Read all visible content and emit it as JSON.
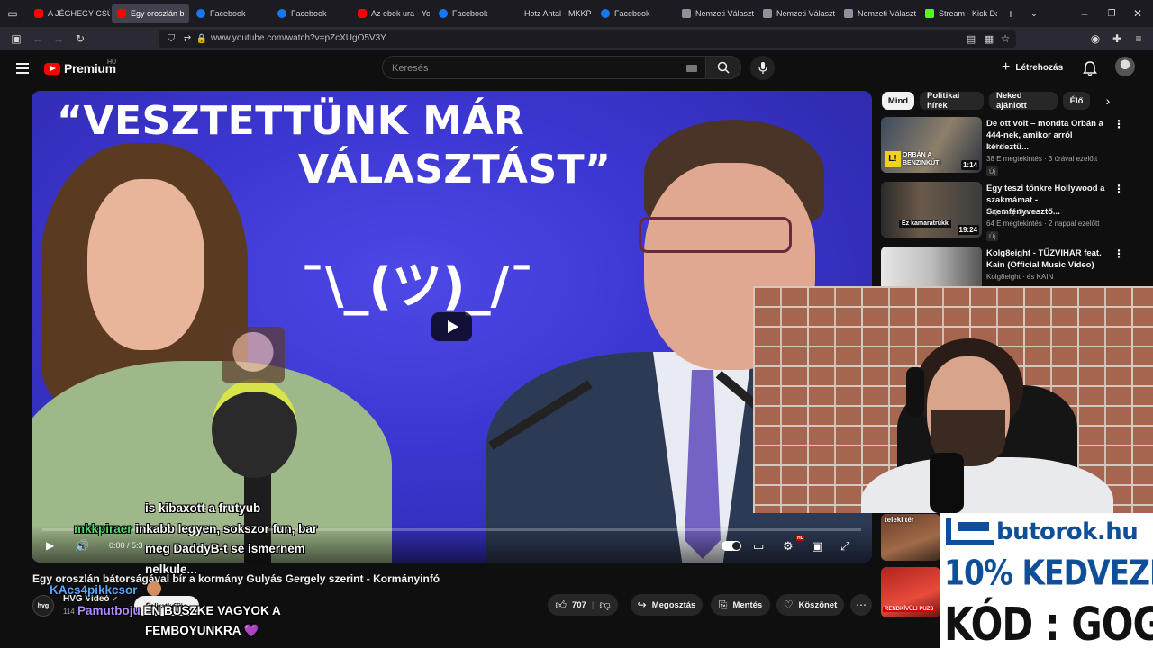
{
  "browser": {
    "tabs": [
      {
        "label": "A JÉGHEGY CSÚC",
        "icon": "youtube-icon",
        "active": false
      },
      {
        "label": "Egy oroszlán b",
        "icon": "youtube-icon",
        "active": true
      },
      {
        "label": "Facebook",
        "icon": "facebook-icon",
        "active": false
      },
      {
        "label": "Facebook",
        "icon": "facebook-icon",
        "active": false
      },
      {
        "label": "Az ebek ura - You",
        "icon": "youtube-icon",
        "active": false
      },
      {
        "label": "Facebook",
        "icon": "facebook-icon",
        "active": false
      },
      {
        "label": "Hotz Antal - MKKP",
        "icon": "none",
        "active": false
      },
      {
        "label": "Facebook",
        "icon": "facebook-icon",
        "active": false
      },
      {
        "label": "Nemzeti Választá",
        "icon": "document-icon",
        "active": false
      },
      {
        "label": "Nemzeti Választá",
        "icon": "document-icon",
        "active": false
      },
      {
        "label": "Nemzeti Választá",
        "icon": "document-icon",
        "active": false
      },
      {
        "label": "Stream - Kick Da",
        "icon": "kick-icon",
        "active": false
      }
    ],
    "url": "www.youtube.com/watch?v=pZcXUgO5V3Y"
  },
  "header": {
    "logo_text": "Premium",
    "logo_region": "HU",
    "search_placeholder": "Keresés",
    "create_label": "Létrehozás"
  },
  "video": {
    "thumb_title_line1": "“VESZTETTÜNK MÁR",
    "thumb_title_line2": "VÁLASZTÁST”",
    "thumb_shrug": "¯\\_(ツ)_/¯",
    "time": "0:00 / 5:3",
    "progress": 0,
    "title": "Egy oroszlán bátorságával bír a kormány Gulyás Gergely szerint - Kormányinfó",
    "channel_name": "HVG Videó",
    "channel_avatar_text": "hvg",
    "subscribers": "114",
    "subscribe_label": "Feliratkozás",
    "likes": "707",
    "share_label": "Megosztás",
    "save_label": "Mentés",
    "thanks_label": "Köszönet"
  },
  "chips": [
    "Mind",
    "Politikai hírek",
    "Neked ajánlott",
    "Élő"
  ],
  "recommendations": [
    {
      "title": "De ott volt – mondta Orbán a 444-nek, amikor arról kérdeztü...",
      "channel": "444.hu",
      "meta": "38 E megtekintés · 3 órával ezelőtt",
      "badge": "Új",
      "duration": "1:14",
      "thumb_text": "ORBÁN A BENZINKÚTI"
    },
    {
      "title": "Egy teszi tönkre Hollywood a szakmámat - Szemfényvesztő...",
      "channel": "Hajnóczy Soma",
      "meta": "64 E megtekintés · 2 nappal ezelőtt",
      "badge": "Új",
      "duration": "19:24",
      "thumb_text": "Ez kamaratrükk"
    },
    {
      "title": "Kolg8eight - TŰZVIHAR feat. Kain (Official Music Video)",
      "channel": "Kolg8eight · és KAIN",
      "meta": "",
      "badge": "",
      "duration": "",
      "thumb_text": ""
    }
  ],
  "partial_recs": [
    "teleki tér",
    "RENDKÍVÜLI PUZS"
  ],
  "chat": [
    {
      "text": "is kibaxott a frutyub",
      "user": "",
      "faded": false
    },
    {
      "user": "mkkpiraer",
      "text": "inkabb legyen, sokszor fun, bar",
      "faded": false
    },
    {
      "text": "meg DaddyB-t se ismernem",
      "user": "",
      "faded": false
    },
    {
      "text": "nelkule...",
      "user": "",
      "faded": false
    },
    {
      "user": "KAcs4pikkcsor",
      "text": "",
      "faded": false
    },
    {
      "user": "Pamutboju",
      "text": "ÉN BÜSZKE VAGYOK A",
      "faded": false
    },
    {
      "text": "FEMBOYUNKRA 💜",
      "user": "",
      "faded": false
    }
  ],
  "ad": {
    "brand": "butorok.hu",
    "line1": "10% KEDVEZMÉNY",
    "line2": "KÓD : GOGGER"
  },
  "colors": {
    "accent": "#ff0000",
    "ad_blue": "#0f4f9a",
    "chat_user_green": "#52d96b",
    "chat_user_blue": "#5aa9ff",
    "chat_user_purple": "#b18cff"
  }
}
